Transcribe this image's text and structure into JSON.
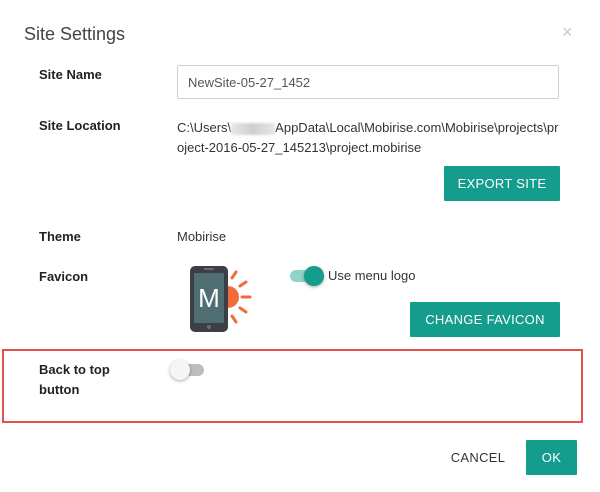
{
  "dialog": {
    "title": "Site Settings",
    "close_glyph": "×"
  },
  "site_name": {
    "label": "Site Name",
    "value": "NewSite-05-27_1452"
  },
  "site_location": {
    "label": "Site Location",
    "path_prefix": "C:\\Users\\",
    "path_suffix": "AppData\\Local\\Mobirise.com\\Mobirise\\projects\\project-2016-05-27_145213\\project.mobirise",
    "export_button": "EXPORT SITE"
  },
  "theme": {
    "label": "Theme",
    "value": "Mobirise"
  },
  "favicon": {
    "label": "Favicon",
    "icon_letter": "M",
    "use_menu_logo_label": "Use menu logo",
    "use_menu_logo_on": true,
    "change_button": "CHANGE FAVICON"
  },
  "back_to_top": {
    "label_line1": "Back to top",
    "label_line2": "button",
    "enabled": false
  },
  "footer": {
    "cancel": "CANCEL",
    "ok": "OK"
  },
  "colors": {
    "accent": "#149c8c",
    "highlight_border": "#e0524b",
    "icon_sun": "#f26b3a",
    "phone_body": "#3c3f44",
    "phone_screen": "#4f6e72"
  }
}
